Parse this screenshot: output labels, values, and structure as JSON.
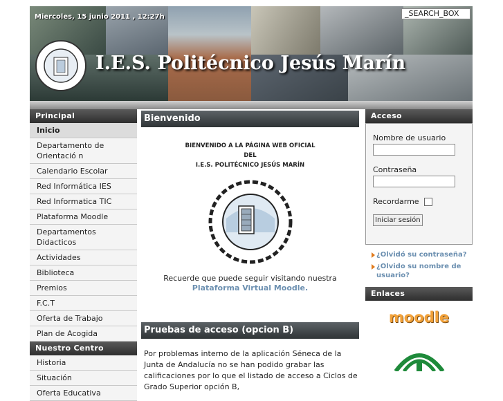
{
  "header": {
    "date": "Miercoles, 15 junio 2011 , 12:27h",
    "search_placeholder": "_SEARCH_BOX",
    "title": "I.E.S. Politécnico Jesús Marín",
    "logo_icon": "school-seal-icon"
  },
  "left": {
    "principal_title": "Principal",
    "principal_items": [
      "Inicio",
      "Departamento de Orientació n",
      "Calendario Escolar",
      "Red Informática IES",
      "Red Informatica TIC",
      "Plataforma Moodle",
      "Departamentos Didacticos",
      "Actividades",
      "Biblioteca",
      "Premios",
      "F.C.T",
      "Oferta de Trabajo",
      "Plan de Acogida"
    ],
    "centro_title": "Nuestro Centro",
    "centro_items": [
      "Historia",
      "Situación",
      "Oferta Educativa"
    ]
  },
  "center": {
    "section1_title": "Bienvenido",
    "welcome_line1": "BIENVENIDO A LA PÁGINA WEB OFICIAL",
    "welcome_line2": "DEL",
    "welcome_line3": "I.E.S. POLITÉCNICO JESÚS MARÍN",
    "remember_text": "Recuerde que puede seguir visitando nuestra",
    "remember_link": "Plataforma Virtual Moodle.",
    "section2_title": "Pruebas de acceso (opcion B)",
    "section2_text": "Por problemas interno de la aplicación Séneca de la Junta de Andalucía no se han podido grabar las calificaciones por lo que el listado de acceso a Ciclos de Grado Superior opción B,"
  },
  "right": {
    "acceso_title": "Acceso",
    "username_label": "Nombre de usuario",
    "password_label": "Contraseña",
    "remember_label": "Recordarme",
    "login_button": "Iniciar sesión",
    "forgot_password": "¿Olvidó su contraseña?",
    "forgot_username": "¿Olvido su nombre de usuario?",
    "enlaces_title": "Enlaces",
    "moodle_logo_text": "moodle",
    "accent_orange": "#e07a1c",
    "link_blue": "#6b8fb0"
  }
}
